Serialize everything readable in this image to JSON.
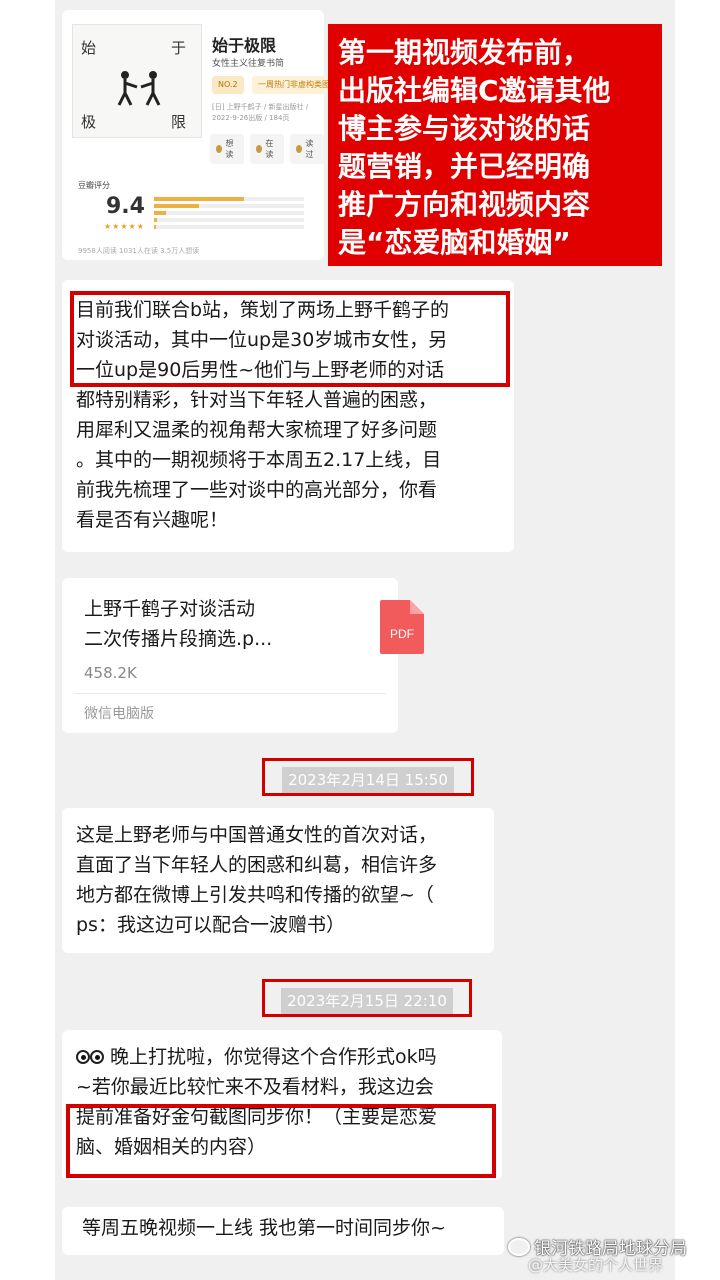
{
  "book_card": {
    "cover_chars": [
      "始",
      "于",
      "极",
      "限"
    ],
    "title": "始于极限",
    "subtitle": "女性主义往复书简",
    "rank_badge": "NO.2",
    "rank_text": "一周热门非虚构类图书",
    "meta": "[日] 上野千鹤子 / 新星出版社 / 2022-9-26出版 / 184页",
    "actions": [
      "想读",
      "在读",
      "读过"
    ],
    "score_label": "豆瓣评分",
    "score": "9.4",
    "stars": "★★★★★",
    "rating_fractions": [
      0.6,
      0.3,
      0.08,
      0.02,
      0.01
    ],
    "footer": "9958人阅读   1031人在读   3.5万人想读"
  },
  "annotation": {
    "lines": [
      "第一期视频发布前，",
      "出版社编辑C邀请其他",
      "博主参与该对谈的话",
      "题营销，并已经明确",
      "推广方向和视频内容",
      "是“恋爱脑和婚姻”"
    ],
    "color": "#e00000"
  },
  "messages": {
    "msg1": [
      "目前我们联合b站，策划了两场上野千鹤子的",
      "对谈活动，其中一位up是30岁城市女性，另",
      "一位up是90后男性~他们与上野老师的对话",
      "都特别精彩，针对当下年轻人普遍的困惑，",
      "用犀利又温柔的视角帮大家梳理了好多问题",
      "。其中的一期视频将于本周五2.17上线，目",
      "前我先梳理了一些对谈中的高光部分，你看",
      "看是否有兴趣呢！"
    ],
    "file": {
      "name_lines": [
        "上野千鹤子对谈活动",
        "二次传播片段摘选.p..."
      ],
      "size": "458.2K",
      "source": "微信电脑版",
      "icon_label": "PDF"
    },
    "timestamp1": "2023年2月14日 15:50",
    "msg2": [
      "这是上野老师与中国普通女性的首次对话，",
      "直面了当下年轻人的困惑和纠葛，相信许多",
      "地方都在微博上引发共鸣和传播的欲望~（",
      "ps：我这边可以配合一波赠书）"
    ],
    "timestamp2": "2023年2月15日 22:10",
    "msg3_first": "晚上打扰啦，你觉得这个合作形式ok吗",
    "msg3": [
      "~若你最近比较忙来不及看材料，我这边会",
      "提前准备好金句截图同步你！（主要是恋爱",
      "脑、婚姻相关的内容）"
    ],
    "msg4": "等周五晚视频一上线 我也第一时间同步你~"
  },
  "watermark": {
    "line1": "银河铁路局地球分局",
    "line2": "@大美女的个人世界"
  }
}
